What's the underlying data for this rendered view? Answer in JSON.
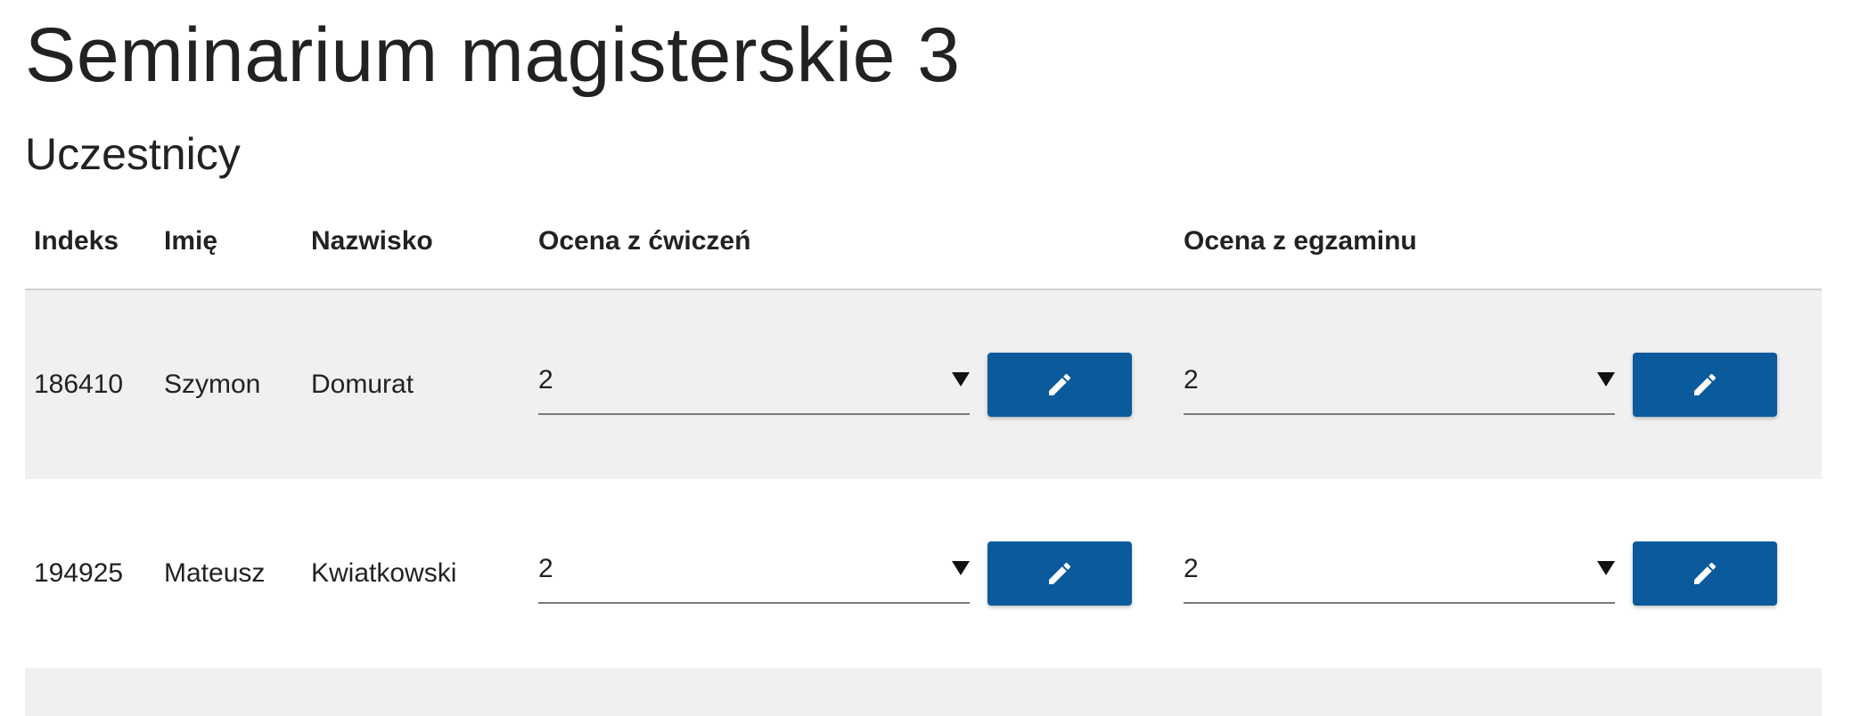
{
  "page_title": "Seminarium magisterskie 3",
  "section_title": "Uczestnicy",
  "colors": {
    "accent": "#0a5a9c",
    "row_shaded": "#f0f0f0",
    "text": "#222222"
  },
  "table": {
    "headers": {
      "index": "Indeks",
      "first_name": "Imię",
      "last_name": "Nazwisko",
      "exercise_grade": "Ocena z ćwiczeń",
      "exam_grade": "Ocena z egzaminu"
    },
    "rows": [
      {
        "index": "186410",
        "first_name": "Szymon",
        "last_name": "Domurat",
        "exercise_grade": "2",
        "exam_grade": "2"
      },
      {
        "index": "194925",
        "first_name": "Mateusz",
        "last_name": "Kwiatkowski",
        "exercise_grade": "2",
        "exam_grade": "2"
      }
    ]
  },
  "icons": {
    "edit": "pencil-icon",
    "dropdown": "triangle-down-icon"
  }
}
